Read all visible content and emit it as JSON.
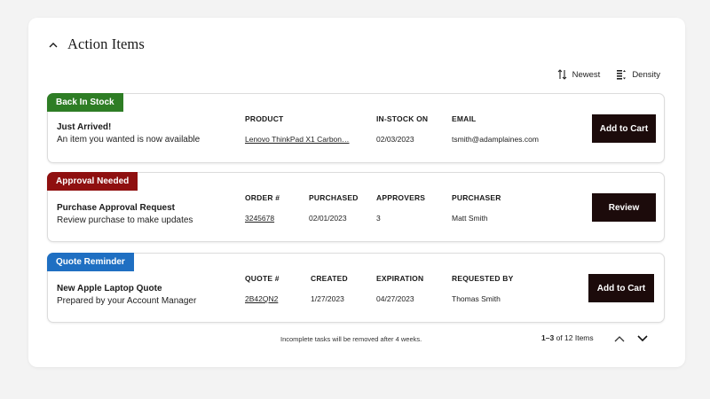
{
  "header": {
    "title": "Action Items"
  },
  "toolbar": {
    "sort_label": "Newest",
    "density_label": "Density"
  },
  "cards": [
    {
      "tag": "Back In Stock",
      "tag_color": "#2e7d25",
      "title": "Just Arrived!",
      "subtitle": "An item you wanted is now available",
      "columns": [
        {
          "header": "PRODUCT",
          "value": "Lenovo ThinkPad X1 Carbon…"
        },
        {
          "header": "IN-STOCK ON",
          "value": "02/03/2023"
        },
        {
          "header": "EMAIL",
          "value": "tsmith@adamplaines.com"
        }
      ],
      "button": "Add to Cart"
    },
    {
      "tag": "Approval Needed",
      "tag_color": "#8f1010",
      "title": "Purchase Approval Request",
      "subtitle": "Review purchase to make updates",
      "columns": [
        {
          "header": "ORDER #",
          "value": "3245678"
        },
        {
          "header": "PURCHASED",
          "value": "02/01/2023"
        },
        {
          "header": "APPROVERS",
          "value": "3"
        },
        {
          "header": "PURCHASER",
          "value": "Matt Smith"
        }
      ],
      "button": "Review"
    },
    {
      "tag": "Quote Reminder",
      "tag_color": "#1f6fc2",
      "title": "New Apple Laptop Quote",
      "subtitle": "Prepared by your Account Manager",
      "columns": [
        {
          "header": "QUOTE #",
          "value": "2B42QN2"
        },
        {
          "header": "CREATED",
          "value": "1/27/2023"
        },
        {
          "header": "EXPIRATION",
          "value": "04/27/2023"
        },
        {
          "header": "REQUESTED BY",
          "value": "Thomas Smith"
        }
      ],
      "button": "Add to Cart"
    }
  ],
  "footer": {
    "note": "Incomplete tasks will be removed after 4 weeks.",
    "range": "1–3",
    "of_label": "of",
    "total": "12 Items"
  }
}
